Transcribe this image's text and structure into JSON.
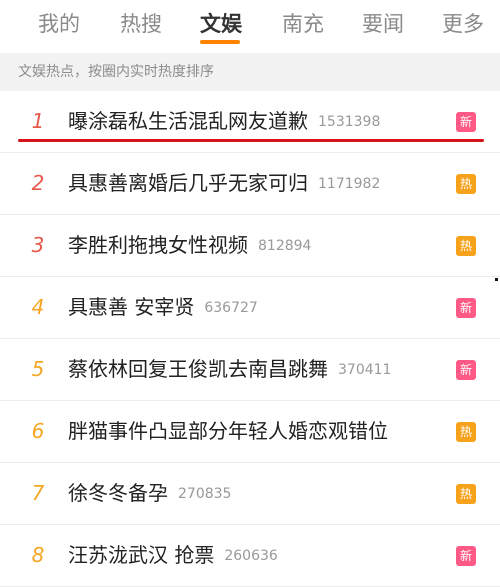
{
  "tabs": [
    "我的",
    "热搜",
    "文娱",
    "南充",
    "要闻",
    "更多"
  ],
  "active_tab": "文娱",
  "subtitle": "文娱热点，按圈内实时热度排序",
  "items": [
    {
      "rank": "1",
      "title": "曝涂磊私生活混乱网友道歉",
      "count": "1531398",
      "badge": "新",
      "badge_type": "new"
    },
    {
      "rank": "2",
      "title": "具惠善离婚后几乎无家可归",
      "count": "1171982",
      "badge": "热",
      "badge_type": "hot"
    },
    {
      "rank": "3",
      "title": "李胜利拖拽女性视频",
      "count": "812894",
      "badge": "热",
      "badge_type": "hot"
    },
    {
      "rank": "4",
      "title": "具惠善 安宰贤",
      "count": "636727",
      "badge": "新",
      "badge_type": "new"
    },
    {
      "rank": "5",
      "title": "蔡依林回复王俊凯去南昌跳舞",
      "count": "370411",
      "badge": "新",
      "badge_type": "new"
    },
    {
      "rank": "6",
      "title": "胖猫事件凸显部分年轻人婚恋观错位",
      "count": "",
      "badge": "热",
      "badge_type": "hot"
    },
    {
      "rank": "7",
      "title": "徐冬冬备孕",
      "count": "270835",
      "badge": "热",
      "badge_type": "hot"
    },
    {
      "rank": "8",
      "title": "汪苏泷武汉 抢票",
      "count": "260636",
      "badge": "新",
      "badge_type": "new"
    }
  ],
  "colors": {
    "rank_top3": "#e65a4d",
    "rank_rest": "#f5a623",
    "badge_new": "#ff5a86",
    "badge_hot": "#f7a21b",
    "highlight_underline": "#d8121a"
  }
}
